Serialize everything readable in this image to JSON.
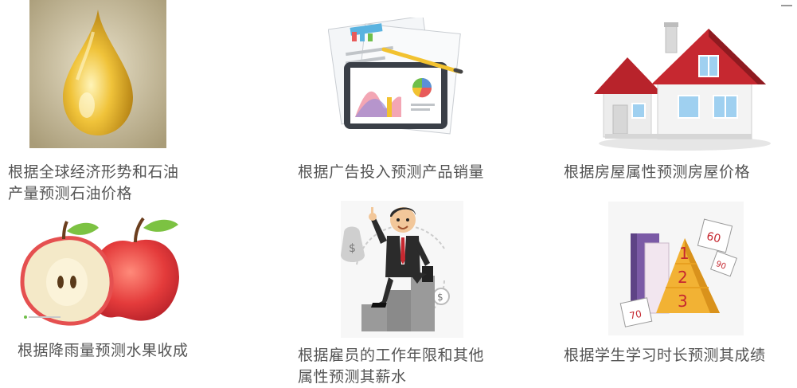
{
  "items": [
    {
      "caption": "根据全球经济形势和石油\n产量预测石油价格",
      "icon": "oil-drop-icon",
      "colors": {
        "drop": "#d9a21c",
        "bg": "#b8ad8c"
      }
    },
    {
      "caption": "根据广告投入预测产品销量",
      "icon": "tablet-chart-icon",
      "colors": {
        "screen": "#ffffff",
        "frame": "#3a3f47"
      }
    },
    {
      "caption": "根据房屋属性预测房屋价格",
      "icon": "house-icon",
      "colors": {
        "roof": "#c62830",
        "wall": "#f2f2f2"
      }
    },
    {
      "caption": "根据降雨量预测水果收成",
      "icon": "apple-icon",
      "colors": {
        "apple": "#e43b3b",
        "leaf": "#7cc242"
      }
    },
    {
      "caption": "根据雇员的工作年限和其他\n属性预测其薪水",
      "icon": "businessman-stairs-icon",
      "colors": {
        "suit": "#2b2b2b",
        "tie": "#c62830"
      }
    },
    {
      "caption": "根据学生学习时长预测其成绩",
      "icon": "grade-pyramid-icon",
      "colors": {
        "pyramid": "#f2b234",
        "book": "#7b5aa6"
      }
    }
  ]
}
